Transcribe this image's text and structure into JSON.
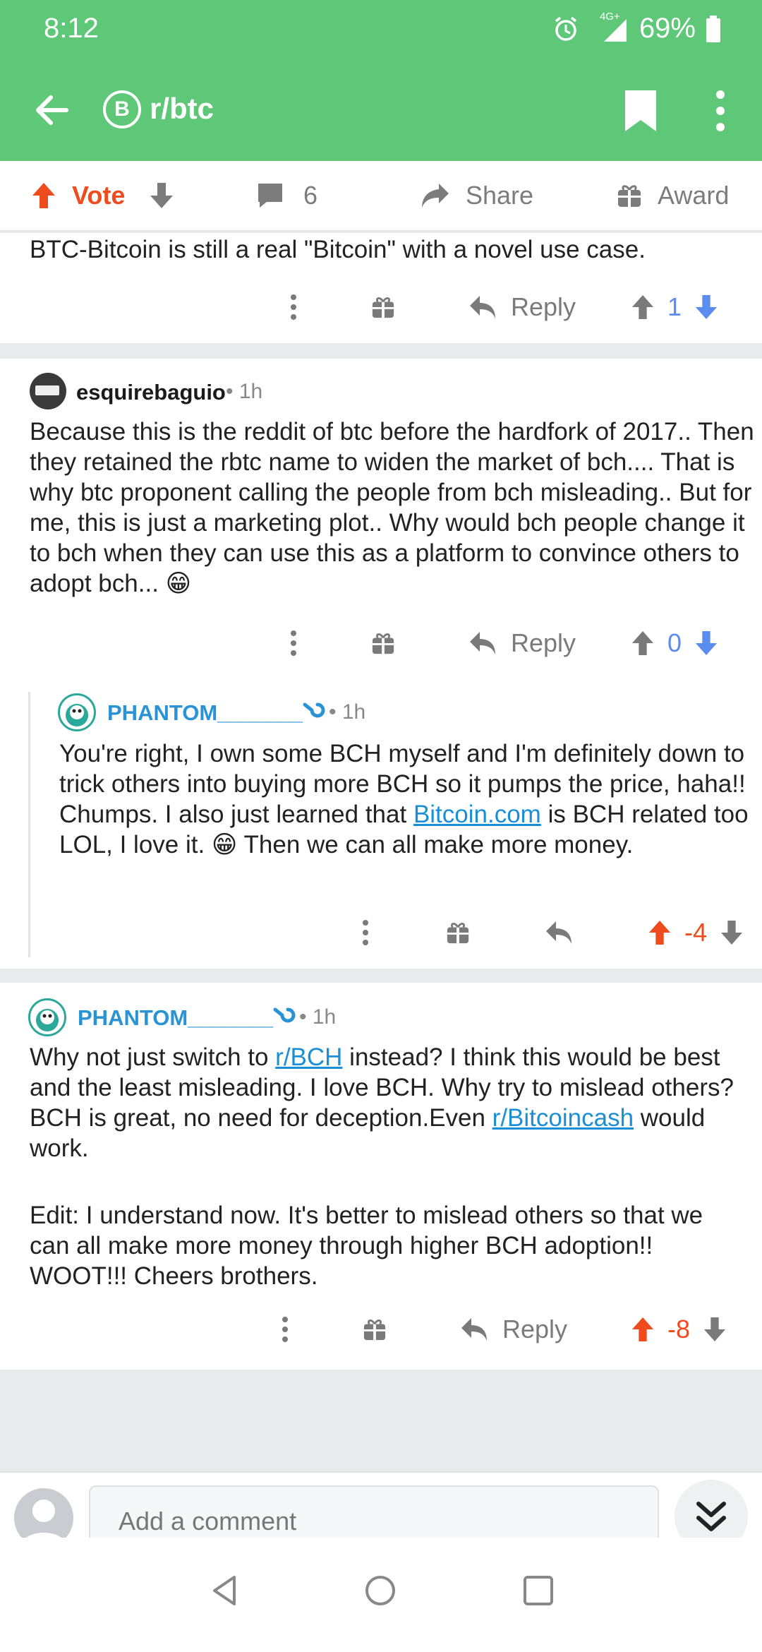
{
  "status_bar": {
    "time": "8:12",
    "network": "4G+",
    "battery": "69%"
  },
  "app_bar": {
    "subreddit": "r/btc",
    "subreddit_icon_letter": "B"
  },
  "post_bar": {
    "vote_label": "Vote",
    "comment_count": "6",
    "share_label": "Share",
    "award_label": "Award"
  },
  "comments": [
    {
      "text": "BTC-Bitcoin is still a real \"Bitcoin\" with a novel use case.",
      "reply_label": "Reply",
      "score": "1"
    },
    {
      "author": "esquirebaguio",
      "time": "1h",
      "text": "Because this is the reddit of btc before the hardfork of 2017.. Then they retained the rbtc name to widen the market of bch.... That is why btc proponent calling the people from bch misleading.. But for me, this is just a marketing plot.. Why would bch people change it to bch when they can use this as a platform to convince others to adopt bch... 😁",
      "reply_label": "Reply",
      "score": "0"
    },
    {
      "author": "PHANTOM_______",
      "time": "1h",
      "text_before_link": "You're right, I own some BCH myself and I'm definitely down to trick others into buying more BCH so it pumps the price, haha!! Chumps. I also just learned that ",
      "link": "Bitcoin.com",
      "text_after_link": " is BCH related too LOL, I love it.  😁  Then we can all make more money.",
      "score": "-4"
    },
    {
      "author": "PHANTOM_______",
      "time": "1h",
      "p1_a": "Why not just switch to ",
      "p1_link1": "r/BCH",
      "p1_b": " instead? I think this would be best and the least misleading. I love BCH. Why try to mislead others? BCH is great, no need for deception.Even ",
      "p1_link2": "r/Bitcoincash",
      "p1_c": " would work.",
      "p2": "Edit: I understand now. It's better to mislead others so that we can all make more money through higher BCH adoption!! WOOT!!! Cheers brothers.",
      "reply_label": "Reply",
      "score": "-8"
    }
  ],
  "composer": {
    "placeholder": "Add a comment"
  },
  "colors": {
    "header_green": "#5ec878",
    "upvote": "#ef4b1d",
    "downvote": "#5b8cf0",
    "link": "#1b8fd6"
  }
}
